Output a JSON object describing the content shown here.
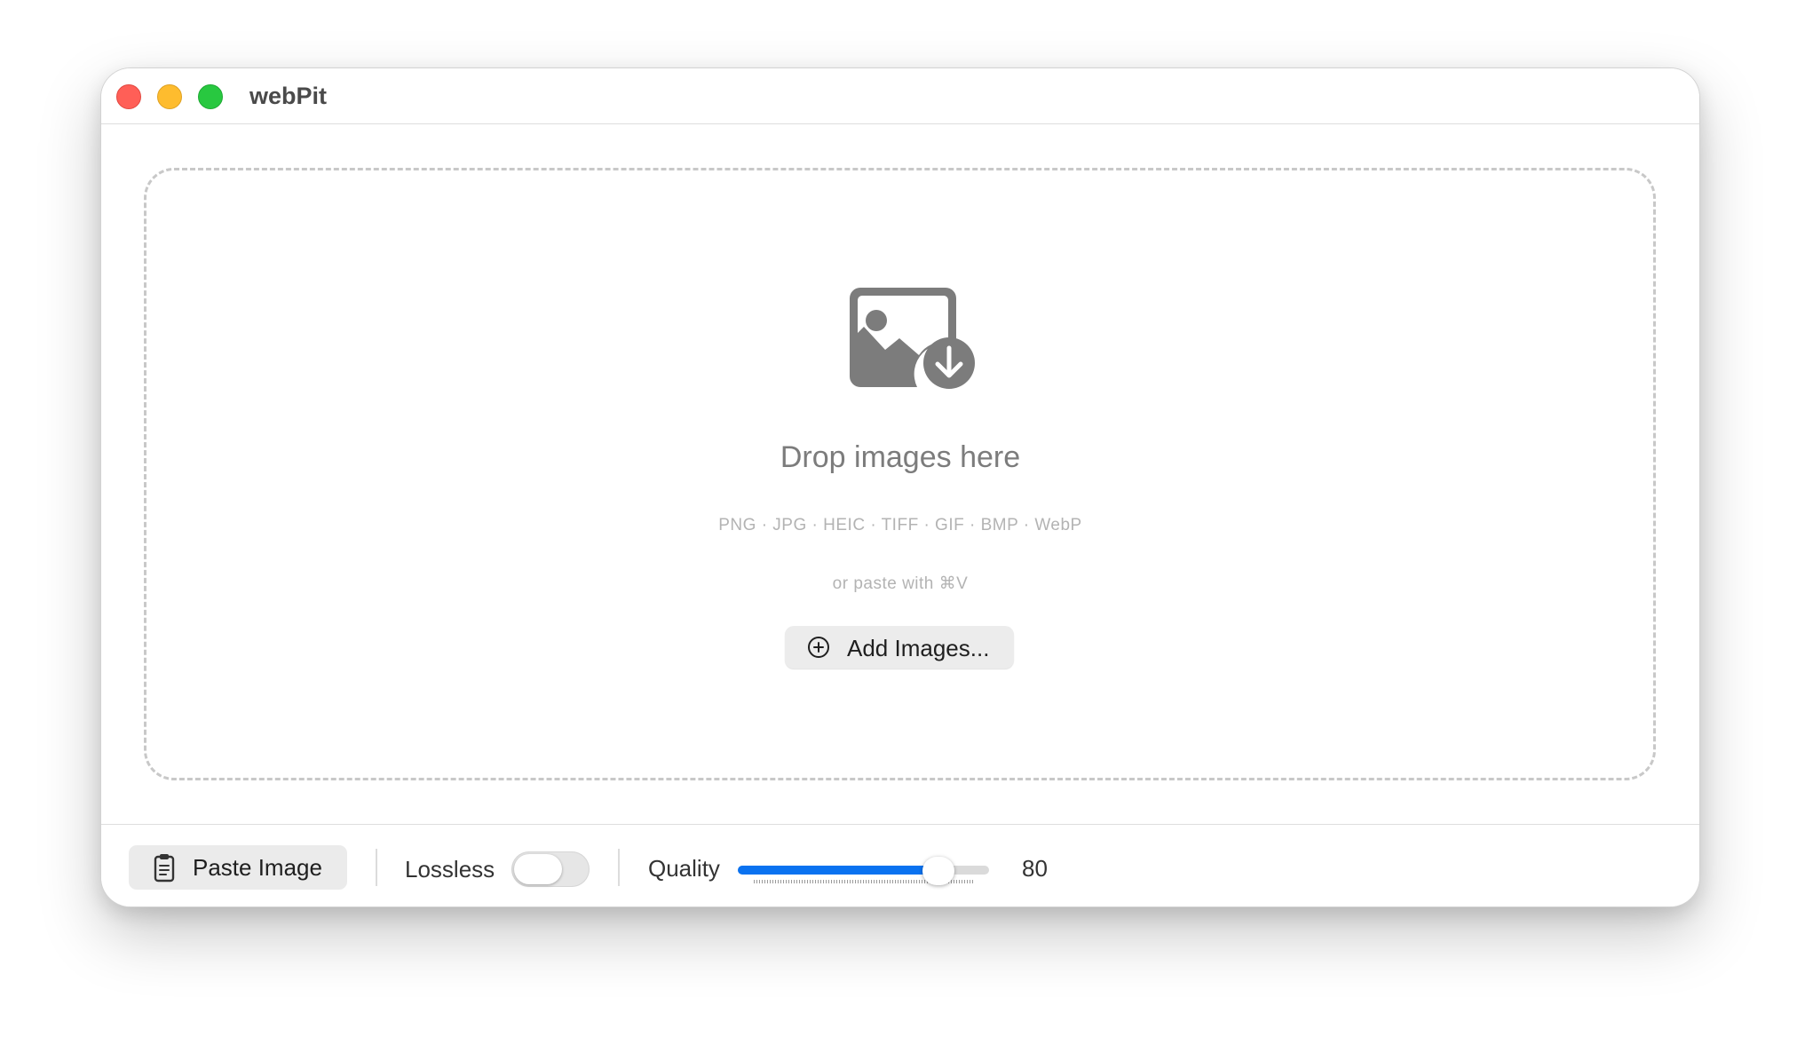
{
  "window": {
    "title": "webPit"
  },
  "dropzone": {
    "icon": "photo-badge-arrow-down-icon",
    "title": "Drop images here",
    "formats": "PNG · JPG · HEIC · TIFF · GIF · BMP · WebP",
    "paste_hint": "or paste with ⌘V",
    "add_button": {
      "icon": "plus-circle-icon",
      "label": "Add Images..."
    }
  },
  "toolbar": {
    "paste_button": {
      "icon": "clipboard-icon",
      "label": "Paste Image"
    },
    "lossless": {
      "label": "Lossless",
      "enabled": false
    },
    "quality": {
      "label": "Quality",
      "value": "80",
      "fraction": 0.8,
      "accent_color": "#0a72f0"
    }
  },
  "colors": {
    "close": "#ff5f57",
    "minimize": "#febc2e",
    "maximize": "#28c840"
  }
}
